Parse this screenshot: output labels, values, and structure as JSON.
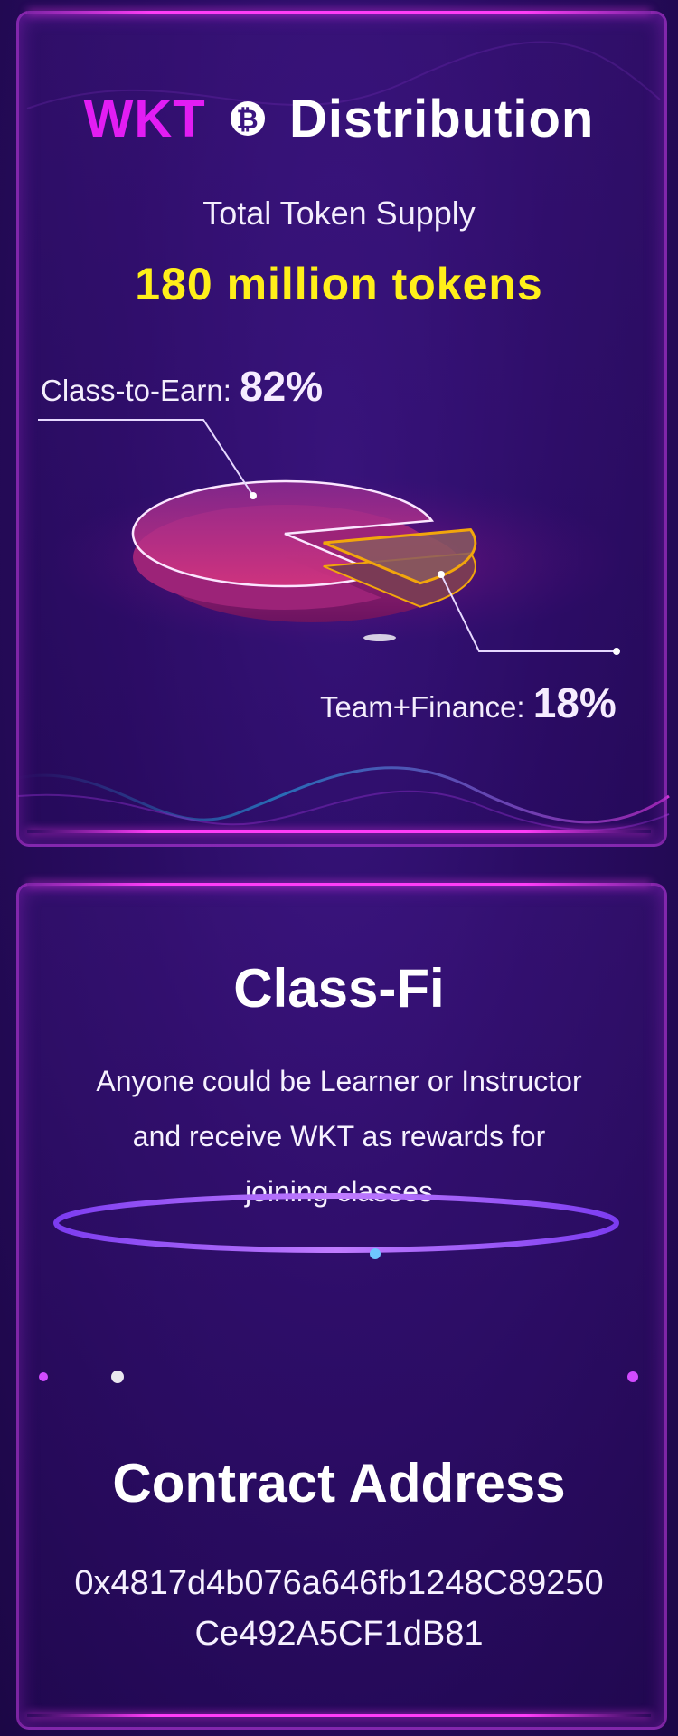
{
  "distribution": {
    "brand": "WKT",
    "title": "Distribution",
    "coin_icon": "bitcoin-coin-icon",
    "supply_label": "Total Token Supply",
    "supply_value": "180 million tokens",
    "chart_data": {
      "type": "pie",
      "slices": [
        {
          "label": "Class-to-Earn:",
          "value": 82,
          "display": "82%"
        },
        {
          "label": "Team+Finance:",
          "value": 18,
          "display": "18%"
        }
      ]
    }
  },
  "classfi": {
    "title": "Class-Fi",
    "description_lines": [
      "Anyone could be Learner or Instructor",
      "and receive WKT as rewards for",
      "joining classes"
    ]
  },
  "contract": {
    "title": "Contract Address",
    "address_lines": [
      "0x4817d4b076a646fb1248C89250",
      "Ce492A5CF1dB81"
    ]
  },
  "colors": {
    "brand": "#e21df3",
    "supply": "#ffef1a",
    "accent": "#ff3df7",
    "slice_orange": "#f2a60c"
  }
}
